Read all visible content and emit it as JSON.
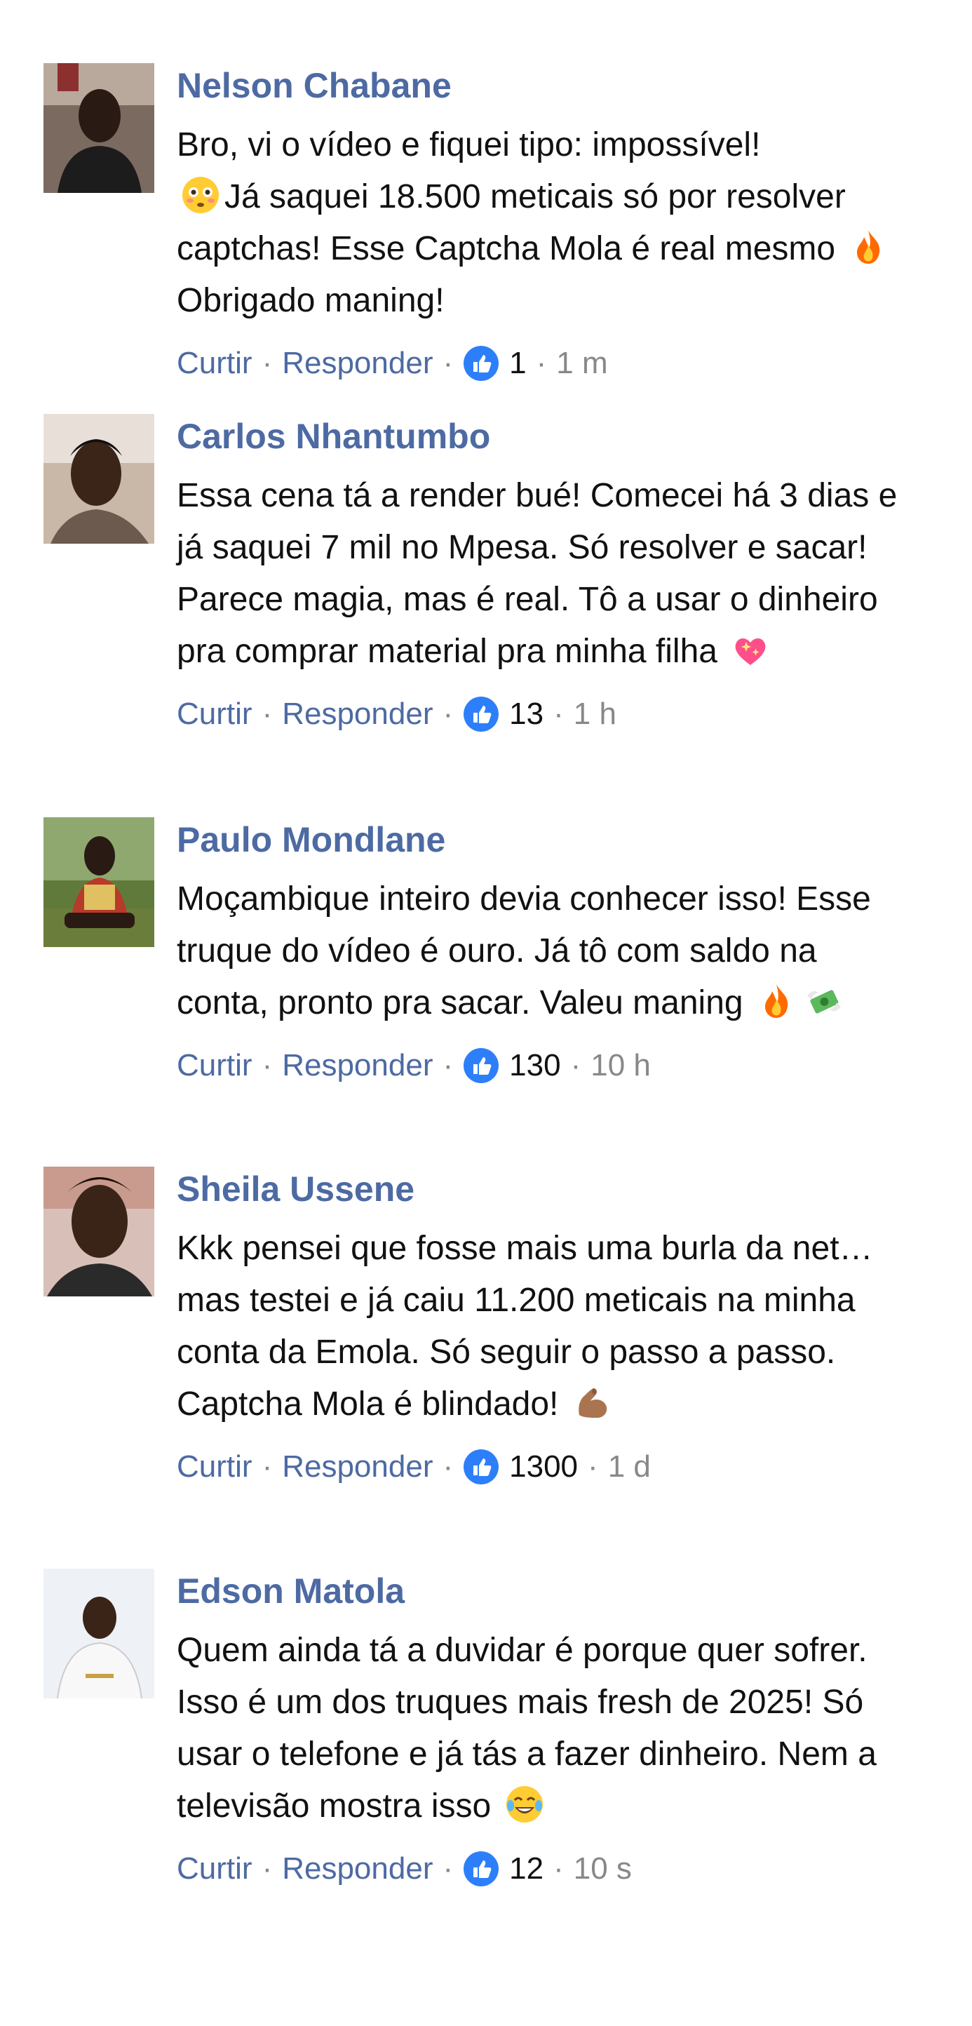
{
  "colors": {
    "author": "#4d6aa3",
    "link": "#4d6aa3",
    "text": "#111111",
    "meta": "#888888",
    "like": "#2d7ff9"
  },
  "actions": {
    "like_label": "Curtir",
    "reply_label": "Responder",
    "separator": "·"
  },
  "comments": [
    {
      "author": "Nelson Chabane",
      "text_parts": [
        "Bro, vi o vídeo e fiquei tipo: impossível! ",
        "Já saquei 18.500 meticais só por resolver captchas! Esse Captcha Mola é real mesmo ",
        "Obrigado maning!"
      ],
      "emojis": [
        "flushed-face-emoji",
        "fire-emoji"
      ],
      "likes": "1",
      "time": "1 m"
    },
    {
      "author": "Carlos Nhantumbo",
      "text_parts": [
        "Essa cena tá a render bué! Comecei há 3 dias e já saquei 7 mil no Mpesa. Só resolver e sacar! Parece magia, mas é real. Tô a usar o dinheiro pra comprar material pra minha filha "
      ],
      "emojis": [
        "sparkling-heart-emoji"
      ],
      "likes": "13",
      "time": "1 h"
    },
    {
      "author": "Paulo Mondlane",
      "text_parts": [
        "Moçambique inteiro devia conhecer isso! Esse truque do vídeo é ouro. Já tô com saldo na conta, pronto pra sacar. Valeu maning "
      ],
      "emojis": [
        "fire-emoji",
        "money-with-wings-emoji"
      ],
      "likes": "130",
      "time": "10 h"
    },
    {
      "author": "Sheila Ussene",
      "text_parts": [
        "Kkk pensei que fosse mais uma burla da net… mas testei e já caiu 11.200 meticais na minha conta da Emola. Só seguir o passo a passo. Captcha Mola é blindado! "
      ],
      "emojis": [
        "flexed-biceps-emoji"
      ],
      "likes": "1300",
      "time": "1 d"
    },
    {
      "author": "Edson Matola",
      "text_parts": [
        "Quem ainda tá a duvidar é porque quer sofrer. Isso é um dos truques mais fresh de 2025! Só usar o telefone e já tás a fazer dinheiro. Nem a televisão mostra isso "
      ],
      "emojis": [
        "tears-of-joy-emoji"
      ],
      "likes": "12",
      "time": "10 s"
    }
  ]
}
